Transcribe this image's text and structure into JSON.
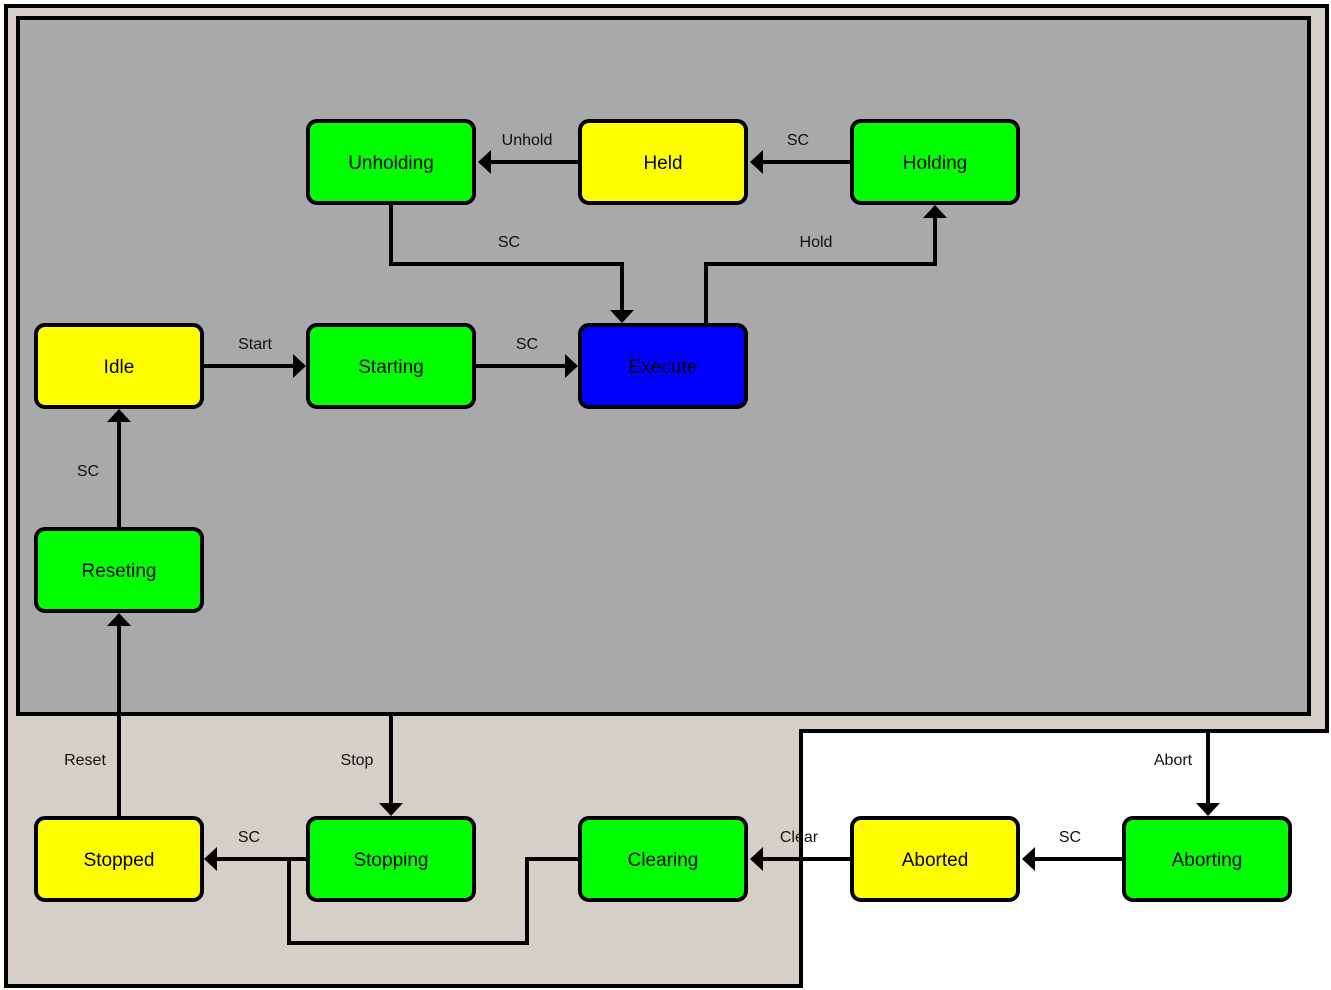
{
  "diagram": {
    "type": "state-machine",
    "colors": {
      "outer_region": "#d4d0c8",
      "inner_region": "#a9a9a9",
      "background": "#ffffff",
      "active_state": "#0000ff",
      "wait_state": "#ffff00",
      "acting_state": "#00ff00",
      "stroke": "#000000"
    },
    "states": [
      {
        "id": "unholding",
        "label": "Unholding",
        "kind": "acting"
      },
      {
        "id": "held",
        "label": "Held",
        "kind": "wait"
      },
      {
        "id": "holding",
        "label": "Holding",
        "kind": "acting"
      },
      {
        "id": "idle",
        "label": "Idle",
        "kind": "wait"
      },
      {
        "id": "starting",
        "label": "Starting",
        "kind": "acting"
      },
      {
        "id": "execute",
        "label": "Execute",
        "kind": "active"
      },
      {
        "id": "reseting",
        "label": "Reseting",
        "kind": "acting"
      },
      {
        "id": "stopped",
        "label": "Stopped",
        "kind": "wait"
      },
      {
        "id": "stopping",
        "label": "Stopping",
        "kind": "acting"
      },
      {
        "id": "clearing",
        "label": "Clearing",
        "kind": "acting"
      },
      {
        "id": "aborted",
        "label": "Aborted",
        "kind": "wait"
      },
      {
        "id": "aborting",
        "label": "Aborting",
        "kind": "acting"
      }
    ],
    "transitions": [
      {
        "id": "held-unholding",
        "from": "held",
        "to": "unholding",
        "label": "Unhold"
      },
      {
        "id": "holding-held",
        "from": "holding",
        "to": "held",
        "label": "SC"
      },
      {
        "id": "unholding-execute",
        "from": "unholding",
        "to": "execute",
        "label": "SC"
      },
      {
        "id": "execute-holding",
        "from": "execute",
        "to": "holding",
        "label": "Hold"
      },
      {
        "id": "idle-starting",
        "from": "idle",
        "to": "starting",
        "label": "Start"
      },
      {
        "id": "starting-execute",
        "from": "starting",
        "to": "execute",
        "label": "SC"
      },
      {
        "id": "reseting-idle",
        "from": "reseting",
        "to": "idle",
        "label": "SC"
      },
      {
        "id": "stopped-reseting",
        "from": "stopped",
        "to": "reseting",
        "label": "Reset"
      },
      {
        "id": "region-stopping",
        "from": "inner-region",
        "to": "stopping",
        "label": "Stop"
      },
      {
        "id": "stopping-stopped",
        "from": "stopping",
        "to": "stopped",
        "label": "SC"
      },
      {
        "id": "clearing-stopping",
        "from": "clearing",
        "to": "stopping",
        "label": ""
      },
      {
        "id": "aborted-clearing",
        "from": "aborted",
        "to": "clearing",
        "label": "Clear"
      },
      {
        "id": "aborting-aborted",
        "from": "aborting",
        "to": "aborted",
        "label": "SC"
      },
      {
        "id": "region-aborting",
        "from": "outer-region",
        "to": "aborting",
        "label": "Abort"
      }
    ]
  }
}
